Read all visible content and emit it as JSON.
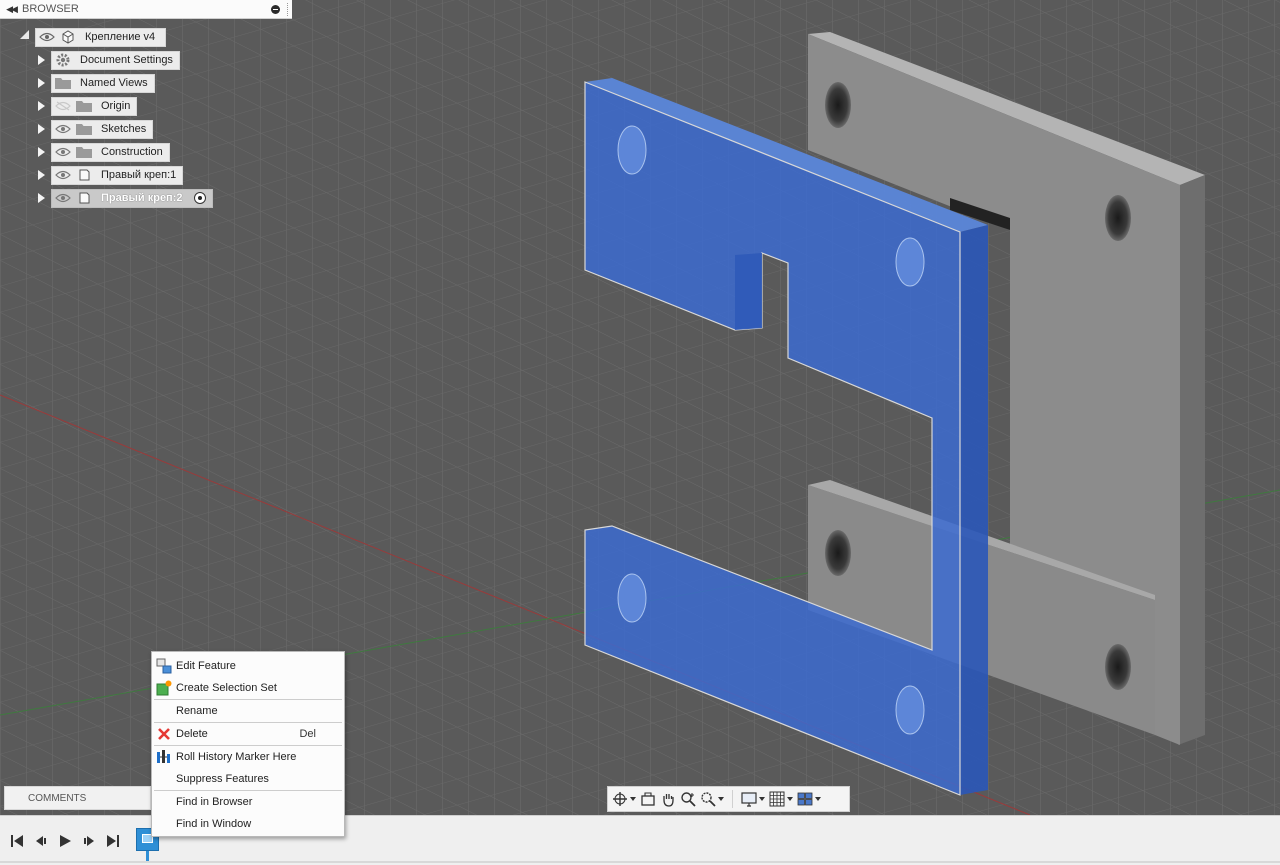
{
  "browser": {
    "title": "BROWSER",
    "root": {
      "label": "Крепление v4"
    },
    "items": [
      {
        "label": "Document Settings",
        "icon": "gear-icon"
      },
      {
        "label": "Named Views",
        "icon": "folder-icon"
      },
      {
        "label": "Origin",
        "icon": "folder-icon",
        "visible": false
      },
      {
        "label": "Sketches",
        "icon": "folder-icon"
      },
      {
        "label": "Construction",
        "icon": "folder-icon"
      },
      {
        "label": "Правый креп:1",
        "icon": "component-icon"
      },
      {
        "label": "Правый креп:2",
        "icon": "component-icon",
        "selected": true
      }
    ]
  },
  "comments": {
    "label": "COMMENTS"
  },
  "context_menu": {
    "items": [
      {
        "label": "Edit Feature",
        "icon": "edit-feature-icon"
      },
      {
        "label": "Create Selection Set",
        "icon": "selection-set-icon"
      },
      {
        "label": "Rename",
        "icon": ""
      },
      {
        "label": "Delete",
        "icon": "delete-icon",
        "shortcut": "Del"
      },
      {
        "label": "Roll History Marker Here",
        "icon": "history-marker-icon"
      },
      {
        "label": "Suppress Features",
        "icon": ""
      },
      {
        "label": "Find in Browser",
        "icon": ""
      },
      {
        "label": "Find in Window",
        "icon": ""
      }
    ]
  },
  "navbar": {
    "buttons": [
      "orbit-icon",
      "look-at-icon",
      "pan-icon",
      "zoom-icon",
      "zoom-window-icon",
      "display-settings-icon",
      "grid-settings-icon",
      "viewports-icon"
    ]
  },
  "timeline": {
    "controls": [
      "go-to-start-icon",
      "step-back-icon",
      "play-icon",
      "step-forward-icon",
      "go-to-end-icon"
    ]
  },
  "colors": {
    "canvas": "#5b5b5b",
    "grid": "#6a6a6a",
    "selected_body": "#3c6bd0",
    "part_body": "#8a8a8a",
    "accent": "#2f8fd6"
  }
}
